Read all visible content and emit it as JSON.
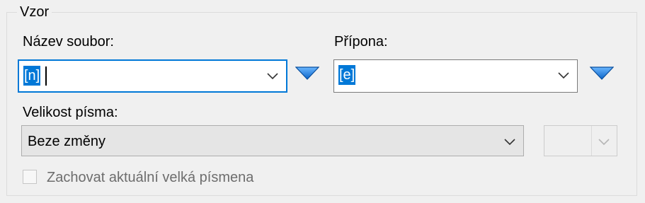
{
  "group": {
    "title": "Vzor"
  },
  "filename": {
    "label": "Název soubor:",
    "value": "[n]"
  },
  "extension": {
    "label": "Přípona:",
    "value": "[e]"
  },
  "font_size": {
    "label": "Velikost písma:",
    "value": "Beze změny",
    "secondary_value": ""
  },
  "keep_uppercase": {
    "label": "Zachovat aktuální velká písmena",
    "checked": false,
    "enabled": false
  },
  "colors": {
    "accent": "#0078d7",
    "arrow_fill": "#1e88e5"
  },
  "icons": [
    "chevron-down-icon",
    "triangle-down-icon"
  ]
}
